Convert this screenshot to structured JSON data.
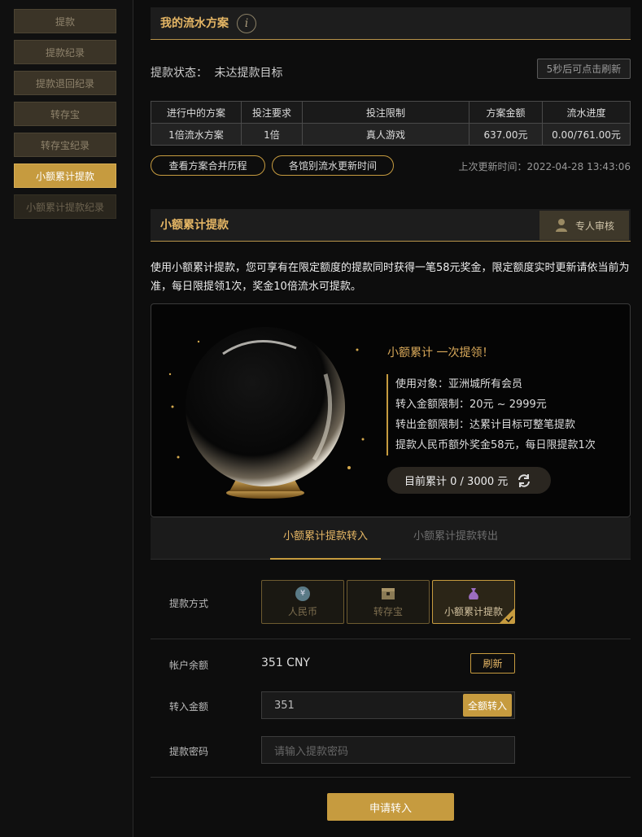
{
  "sidebar": {
    "items": [
      {
        "label": "提款"
      },
      {
        "label": "提款纪录"
      },
      {
        "label": "提款退回纪录"
      },
      {
        "label": "转存宝"
      },
      {
        "label": "转存宝纪录"
      },
      {
        "label": "小额累计提款"
      },
      {
        "label": "小额累计提款纪录"
      }
    ],
    "active_index": 5
  },
  "plan": {
    "title": "我的流水方案",
    "info_icon": "info-icon",
    "status_label": "提款状态：",
    "status_value": "未达提款目标",
    "refresh_hint": "5秒后可点击刷新",
    "table": {
      "headers": [
        "进行中的方案",
        "投注要求",
        "投注限制",
        "方案金额",
        "流水进度"
      ],
      "rows": [
        [
          "1倍流水方案",
          "1倍",
          "真人游戏",
          "637.00元",
          "0.00/761.00元"
        ]
      ]
    },
    "history_button": "查看方案合并历程",
    "venue_button": "各馆别流水更新时间",
    "last_update": "上次更新时间：2022-04-28 13:43:06"
  },
  "small": {
    "title": "小额累计提款",
    "review_label": "专人审核",
    "review_icon": "person-icon",
    "description": "使用小额累计提款，您可享有在限定额度的提款同时获得一笔58元奖金，限定额度实时更新请依当前为准，每日限提领1次，奖金10倍流水可提款。",
    "promo": {
      "headline": "小额累计 一次提领！",
      "lines": [
        "使用对象：亚洲城所有会员",
        "转入金额限制：20元 ~ 2999元",
        "转出金额限制：达累计目标可整笔提款",
        "提款人民币额外奖金58元，每日限提款1次"
      ],
      "progress_label": "目前累计 0 / 3000 元",
      "progress_fraction": 0,
      "refresh_icon": "refresh-icon",
      "image_icon": "crystal-ball-icon"
    },
    "tabs": [
      {
        "label": "小额累计提款转入",
        "active": true
      },
      {
        "label": "小额累计提款转出",
        "active": false
      }
    ]
  },
  "form": {
    "method_label": "提款方式",
    "methods": [
      {
        "label": "人民币",
        "icon": "yuan-icon",
        "selected": false
      },
      {
        "label": "转存宝",
        "icon": "chest-icon",
        "selected": false
      },
      {
        "label": "小额累计提款",
        "icon": "money-bag-icon",
        "selected": true
      }
    ],
    "balance_label": "帐户余额",
    "balance_value": "351 CNY",
    "refresh_button": "刷新",
    "amount_label": "转入金额",
    "amount_value": "351",
    "all_in_button": "全额转入",
    "password_label": "提款密码",
    "password_placeholder": "请输入提款密码",
    "submit_button": "申请转入"
  },
  "colors": {
    "accent": "#c69b3f",
    "title_gold": "#e6b765",
    "background": "#0d0d0d"
  }
}
